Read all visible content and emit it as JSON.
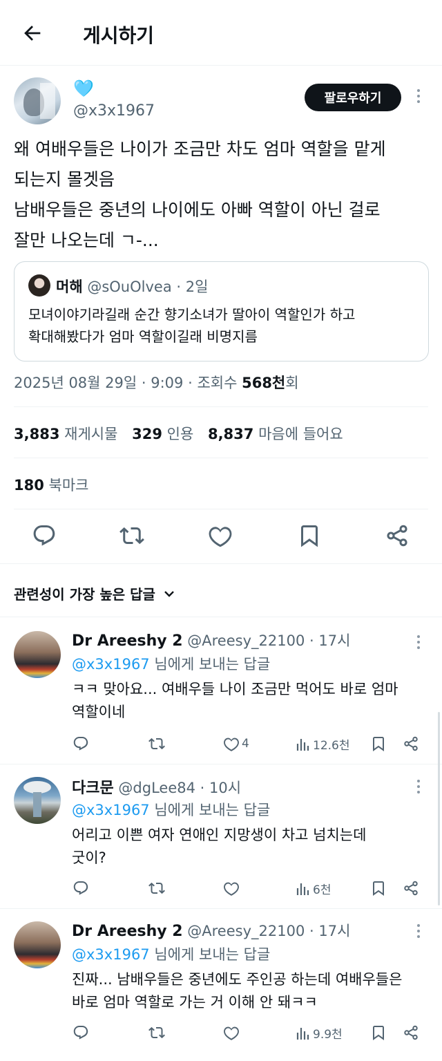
{
  "header": {
    "title": "게시하기"
  },
  "post": {
    "author_emoji": "🩵",
    "handle": "@x3x1967",
    "follow_label": "팔로우하기",
    "text_lines": [
      "왜 여배우들은 나이가 조금만 차도 엄마 역할을 맡게",
      "되는지 몰겟음",
      "남배우들은 중년의 나이에도 아빠 역할이 아닌 걸로",
      "잘만 나오는데 ㄱ-..."
    ],
    "quote": {
      "name": "머해",
      "handle": "@sOuOlvea",
      "time": "· 2일",
      "text_lines": [
        "모녀이야기라길래 순간 향기소녀가 딸아이 역할인가 하고",
        "확대해봤다가 엄마 역할이길래 비명지름"
      ]
    },
    "meta": {
      "date": "2025년 08월 29일",
      "time": "· 9:09 ·",
      "views_prefix": "조회수",
      "views": "568천",
      "views_suffix": "회"
    },
    "stats": {
      "reposts": "3,883",
      "reposts_label": "재게시물",
      "quotes": "329",
      "quotes_label": "인용",
      "likes": "8,837",
      "likes_label": "마음에 들어요",
      "bookmarks": "180",
      "bookmarks_label": "북마크"
    }
  },
  "replies_sort_label": "관련성이 가장 높은 답글",
  "replies": [
    {
      "name": "Dr Areeshy 2",
      "handle": "@Areesy_22100",
      "time": "· 17시",
      "reply_to_handle": "@x3x1967",
      "reply_to_suffix": "님에게 보내는 답글",
      "text_lines": [
        "ㅋㅋ 맞아요... 여배우들 나이 조금만 먹어도 바로 엄마",
        "역할이네"
      ],
      "likes": "4",
      "views": "12.6천"
    },
    {
      "name": "다크문",
      "handle": "@dgLee84",
      "time": "· 10시",
      "reply_to_handle": "@x3x1967",
      "reply_to_suffix": "님에게 보내는 답글",
      "text_lines": [
        "어리고 이쁜 여자 연애인 지망생이 차고 넘치는데",
        "굿이?"
      ],
      "likes": "",
      "views": "6천"
    },
    {
      "name": "Dr Areeshy 2",
      "handle": "@Areesy_22100",
      "time": "· 17시",
      "reply_to_handle": "@x3x1967",
      "reply_to_suffix": "님에게 보내는 답글",
      "text_lines": [
        "진짜... 남배우들은 중년에도 주인공 하는데 여배우들은",
        "바로 엄마 역할로 가는 거 이해 안 돼ㅋㅋ"
      ],
      "likes": "",
      "views": "9.9천"
    }
  ],
  "colors": {
    "accent": "#1d9bf0",
    "text": "#0f1419",
    "muted": "#536471",
    "divider": "#eff3f4"
  }
}
